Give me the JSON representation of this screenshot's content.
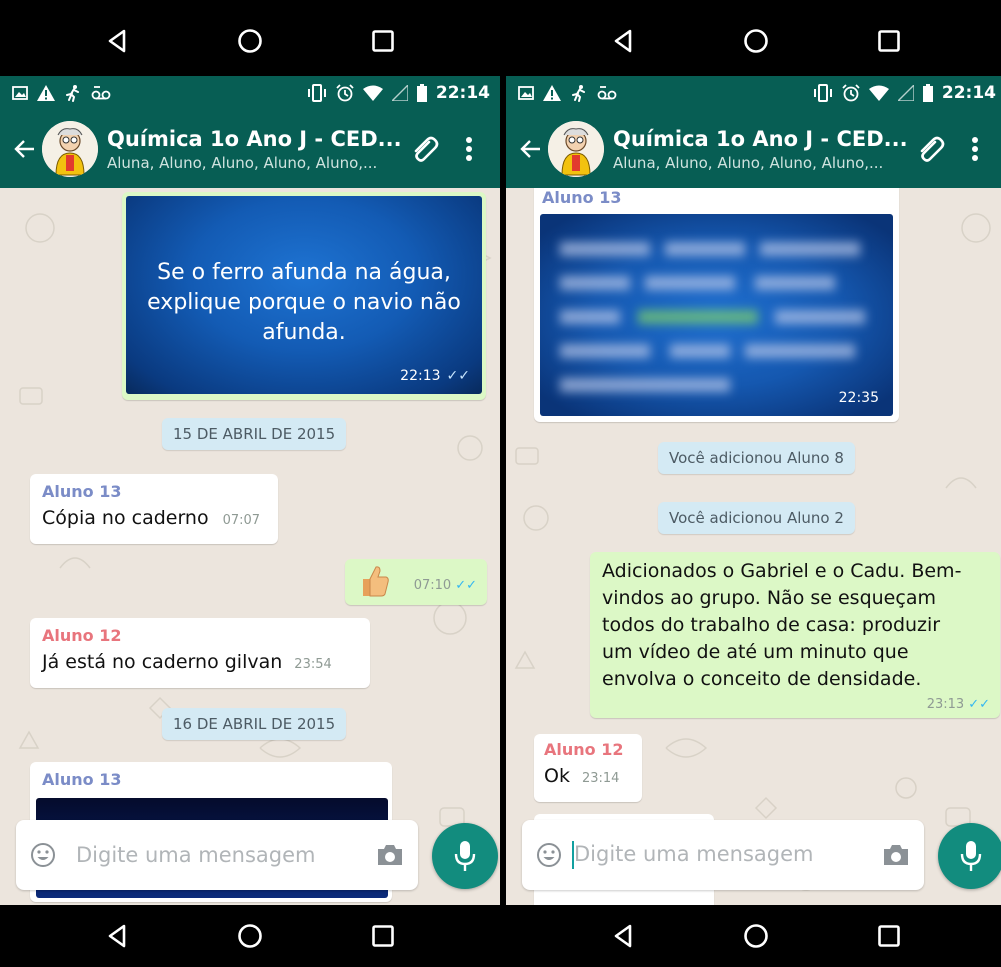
{
  "left": {
    "status": {
      "time": "22:14"
    },
    "appbar": {
      "title": "Química 1o Ano J - CED...",
      "subtitle": "Aluna, Aluno, Aluno, Aluno, Aluno,..."
    },
    "image_msg": {
      "text": "Se o ferro afunda na água, explique porque o navio não afunda.",
      "time": "22:13"
    },
    "date1": "15 DE ABRIL DE 2015",
    "msg1": {
      "sender": "Aluno 13",
      "text": "Cópia no caderno",
      "time": "07:07"
    },
    "msg_thumb": {
      "time": "07:10"
    },
    "msg2": {
      "sender": "Aluno 12",
      "text": "Já está  no caderno gilvan",
      "time": "23:54"
    },
    "date2": "16 DE ABRIL DE 2015",
    "msg3": {
      "sender": "Aluno 13"
    },
    "input": {
      "placeholder": "Digite uma mensagem"
    }
  },
  "right": {
    "status": {
      "time": "22:14"
    },
    "appbar": {
      "title": "Química 1o Ano J - CED...",
      "subtitle": "Aluna, Aluno, Aluno, Aluno, Aluno,..."
    },
    "image_msg": {
      "sender": "Aluno 13",
      "time": "22:35"
    },
    "sys1": "Você adicionou Aluno 8",
    "sys2": "Você adicionou Aluno 2",
    "msg_out": {
      "lines": [
        "Adicionados o Gabriel e o Cadu. Bem-",
        "vindos ao grupo. Não se esqueçam",
        "todos do trabalho de casa: produzir",
        "um vídeo de até um minuto que",
        "envolva o conceito de densidade."
      ],
      "time": "23:13"
    },
    "msg_in": {
      "sender": "Aluno 12",
      "text": "Ok",
      "time": "23:14"
    },
    "input": {
      "placeholder": "Digite uma mensagem"
    }
  },
  "colors": {
    "header": "#075e54",
    "chat_bg": "#ece5dd",
    "outgoing": "#dcf8c6",
    "date_pill": "#d4eaf4",
    "aluno13": "#7b8cc7",
    "aluno12": "#e8757d",
    "mic": "#128c7e",
    "read_tick": "#34b7f1"
  },
  "icons": [
    "back-arrow-icon",
    "group-avatar-icon",
    "paperclip-icon",
    "more-vert-icon",
    "emoji-icon",
    "camera-icon",
    "mic-icon",
    "nav-back-icon",
    "nav-home-icon",
    "nav-recents-icon",
    "image-icon",
    "warning-icon",
    "runner-icon",
    "voicemail-icon",
    "vibrate-icon",
    "alarm-icon",
    "wifi-icon",
    "signal-icon",
    "battery-icon"
  ]
}
